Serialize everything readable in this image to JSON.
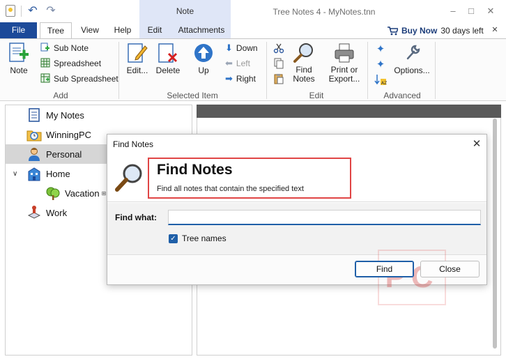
{
  "window": {
    "title": "Tree Notes 4 - MyNotes.tnn",
    "context_tab_group": "Note"
  },
  "tabs": {
    "file": "File",
    "items": [
      "Tree",
      "View",
      "Help",
      "Edit",
      "Attachments"
    ]
  },
  "license": {
    "buy_label": "Buy Now",
    "days_left": "30 days left"
  },
  "ribbon": {
    "add": {
      "note": "Note",
      "sub_note": "Sub Note",
      "spreadsheet": "Spreadsheet",
      "sub_spreadsheet": "Sub Spreadsheet",
      "group": "Add"
    },
    "selected_item": {
      "edit": "Edit...",
      "delete": "Delete",
      "up": "Up",
      "down": "Down",
      "left": "Left",
      "right": "Right",
      "group": "Selected Item"
    },
    "edit": {
      "find_notes_line1": "Find",
      "find_notes_line2": "Notes",
      "print_line1": "Print or",
      "print_line2": "Export...",
      "group": "Edit"
    },
    "advanced": {
      "options": "Options...",
      "group": "Advanced"
    }
  },
  "tree": {
    "items": [
      {
        "label": "My Notes",
        "icon": "note-list-icon"
      },
      {
        "label": "WinningPC",
        "icon": "folder-clock-icon"
      },
      {
        "label": "Personal",
        "icon": "person-icon",
        "selected": true
      },
      {
        "label": "Home",
        "icon": "building-icon",
        "expanded": true
      },
      {
        "label": "Vacation",
        "icon": "tree-icon",
        "child": true
      },
      {
        "label": "Work",
        "icon": "stamp-icon"
      }
    ]
  },
  "dialog": {
    "title": "Find Notes",
    "heading": "Find Notes",
    "subtitle": "Find all notes that contain the specified text",
    "find_label": "Find what:",
    "find_value": "",
    "checkbox_label": "Tree names",
    "checkbox_checked": true,
    "find_button": "Find",
    "close_button": "Close"
  },
  "watermark": "PC"
}
